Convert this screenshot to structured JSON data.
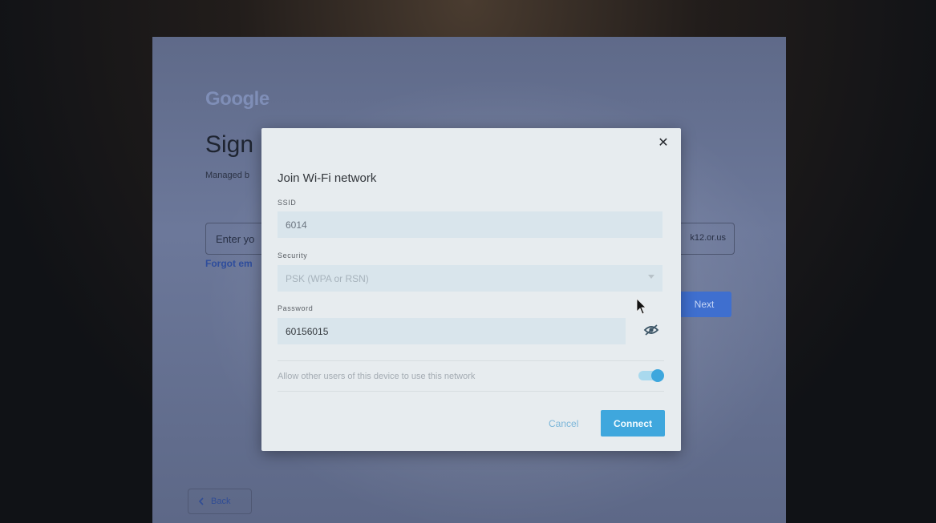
{
  "background": {
    "logo": "Google",
    "title": "Sign",
    "managed_text": "Managed b",
    "input_placeholder": "Enter yo",
    "domain_suffix": "k12.or.us",
    "forgot_link": "Forgot em",
    "next_label": "Next",
    "back_label": "Back"
  },
  "dialog": {
    "title": "Join Wi-Fi network",
    "close_glyph": "✕",
    "ssid": {
      "label": "SSID",
      "value": "6014"
    },
    "security": {
      "label": "Security",
      "value": "PSK (WPA or RSN)"
    },
    "password": {
      "label": "Password",
      "value": "60156015"
    },
    "share_toggle": {
      "label": "Allow other users of this device to use this network",
      "on": true
    },
    "cancel_label": "Cancel",
    "connect_label": "Connect"
  },
  "colors": {
    "accent": "#3fa7dd",
    "google_blue": "#3f6fcf"
  },
  "icons": {
    "close": "close-icon",
    "password_visibility": "eye-off-icon",
    "dropdown": "chevron-down-icon",
    "back": "chevron-left-icon",
    "pointer": "mouse-cursor-icon"
  }
}
